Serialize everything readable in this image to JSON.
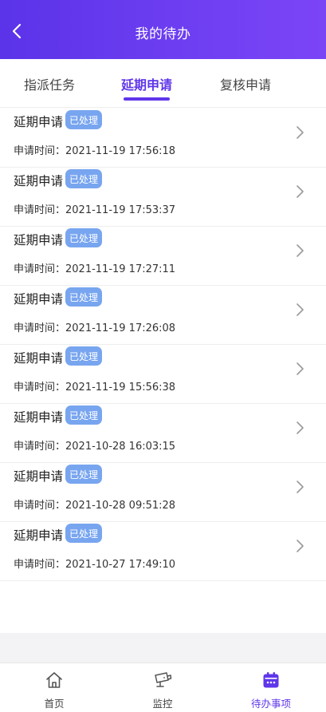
{
  "header": {
    "title": "我的待办",
    "back_icon": "chevron-left-icon"
  },
  "tabs": [
    {
      "label": "指派任务",
      "active": false
    },
    {
      "label": "延期申请",
      "active": true
    },
    {
      "label": "复核申请",
      "active": false
    }
  ],
  "items": [
    {
      "title": "延期申请",
      "badge": "已处理",
      "time": "申请时间：2021-11-19 17:56:18"
    },
    {
      "title": "延期申请",
      "badge": "已处理",
      "time": "申请时间：2021-11-19 17:53:37"
    },
    {
      "title": "延期申请",
      "badge": "已处理",
      "time": "申请时间：2021-11-19 17:27:11"
    },
    {
      "title": "延期申请",
      "badge": "已处理",
      "time": "申请时间：2021-11-19 17:26:08"
    },
    {
      "title": "延期申请",
      "badge": "已处理",
      "time": "申请时间：2021-11-19 15:56:38"
    },
    {
      "title": "延期申请",
      "badge": "已处理",
      "time": "申请时间：2021-10-28 16:03:15"
    },
    {
      "title": "延期申请",
      "badge": "已处理",
      "time": "申请时间：2021-10-28 09:51:28"
    },
    {
      "title": "延期申请",
      "badge": "已处理",
      "time": "申请时间：2021-10-27 17:49:10"
    }
  ],
  "bottom_nav": [
    {
      "label": "首页",
      "icon": "home-icon",
      "active": false
    },
    {
      "label": "监控",
      "icon": "camera-icon",
      "active": false
    },
    {
      "label": "待办事项",
      "icon": "calendar-icon",
      "active": true
    }
  ],
  "colors": {
    "accent": "#5f36ea",
    "badge": "#78a5ef",
    "header_gradient_start": "#5b33e8",
    "header_gradient_end": "#7b45f6"
  }
}
